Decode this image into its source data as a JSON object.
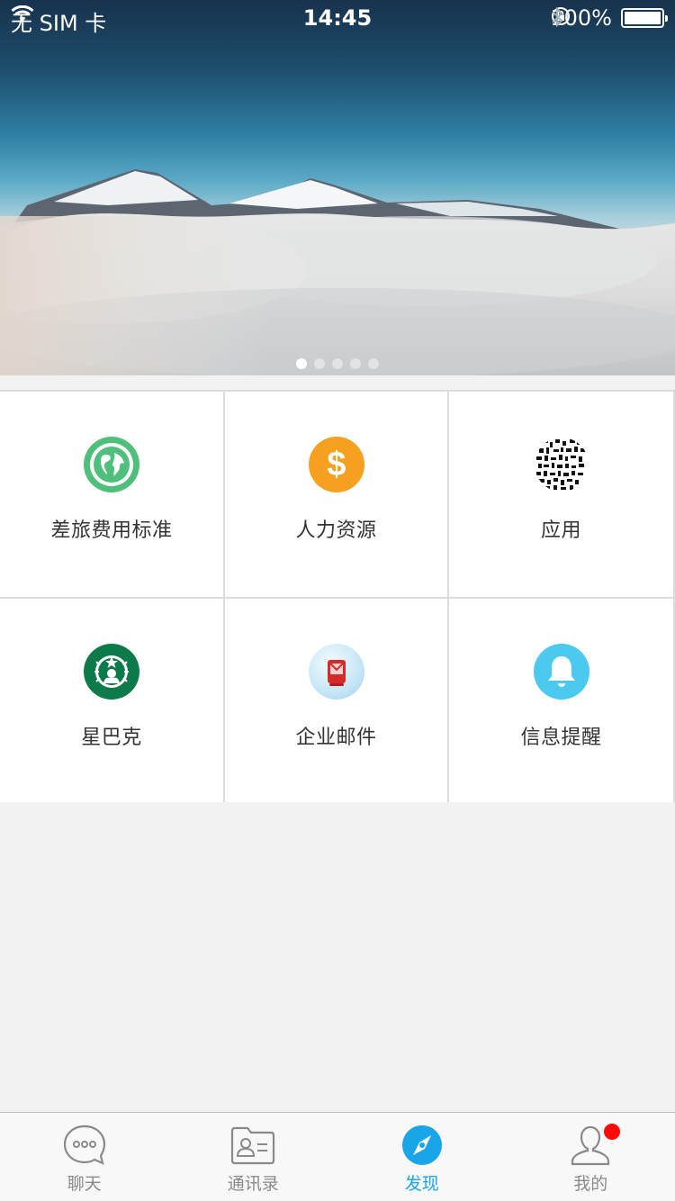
{
  "status_bar": {
    "carrier": "无 SIM 卡",
    "time": "14:45",
    "battery": "100%",
    "icons": [
      "wifi-icon",
      "rotation-lock-icon",
      "bluetooth-icon",
      "battery-icon"
    ]
  },
  "banner": {
    "image": "snowy mountain peaks above clouds",
    "page_count": 5,
    "active_page": 1
  },
  "grid": {
    "items": [
      {
        "label": "差旅费用标准",
        "icon": "globe-icon",
        "color": "#4ec07c"
      },
      {
        "label": "人力资源",
        "icon": "dollar-icon",
        "color": "#f5a01e"
      },
      {
        "label": "应用",
        "icon": "qr-code-icon",
        "color": "#111111"
      },
      {
        "label": "星巴克",
        "icon": "starbucks-logo-icon",
        "color": "#0d7a4a"
      },
      {
        "label": "企业邮件",
        "icon": "mail-icon",
        "color": "#d62b2b"
      },
      {
        "label": "信息提醒",
        "icon": "bell-icon",
        "color": "#4cc9ee"
      }
    ]
  },
  "tabbar": {
    "tabs": [
      {
        "label": "聊天",
        "icon": "chat-bubble-icon",
        "active": false
      },
      {
        "label": "通讯录",
        "icon": "contacts-card-icon",
        "active": false
      },
      {
        "label": "发现",
        "icon": "compass-icon",
        "active": true
      },
      {
        "label": "我的",
        "icon": "person-icon",
        "active": false,
        "badge": true
      }
    ],
    "active_color": "#1aa5e8",
    "inactive_color": "#8a8a8a"
  }
}
